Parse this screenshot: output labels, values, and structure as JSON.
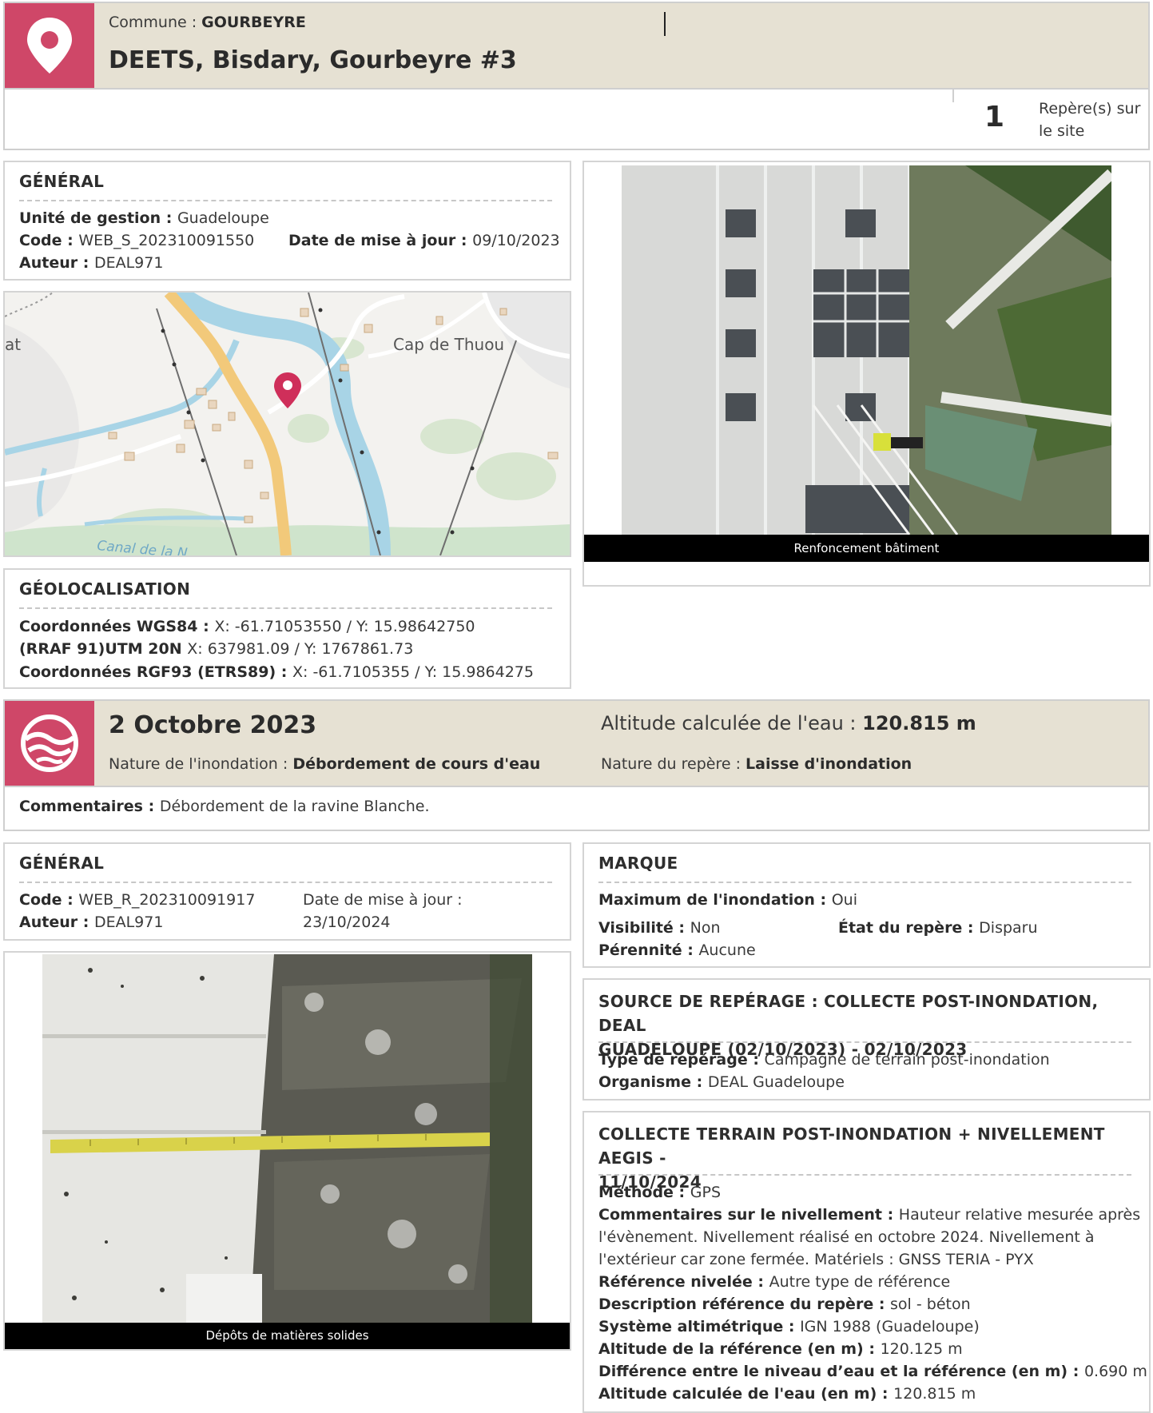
{
  "site_header": {
    "commune_label": "Commune : ",
    "commune_value": "GOURBEYRE",
    "site_title": "DEETS, Bisdary, Gourbeyre #3",
    "marker_count": "1",
    "marker_count_label_line1": "Repère(s) sur",
    "marker_count_label_line2": "le site",
    "accent_color": "#cf4768"
  },
  "site_general": {
    "title": "GÉNÉRAL",
    "unite_label": "Unité de gestion : ",
    "unite_value": "Guadeloupe",
    "code_label": "Code : ",
    "code_value": "WEB_S_202310091550",
    "date_label": "Date de mise à jour : ",
    "date_value": "09/10/2023",
    "auteur_label": "Auteur : ",
    "auteur_value": "DEAL971"
  },
  "map": {
    "label_left": "at",
    "label_place": "Cap de Thuou",
    "label_canal": "Canal de la N",
    "pin_icon": "map-pin-icon"
  },
  "site_photo": {
    "caption": "Renfoncement bâtiment"
  },
  "geoloc": {
    "title": "GÉOLOCALISATION",
    "wgs_label": "Coordonnées WGS84 : ",
    "wgs_value": "X: -61.71053550 / Y: 15.98642750",
    "utm_label": "(RRAF 91)UTM 20N ",
    "utm_value": "X: 637981.09 / Y: 1767861.73",
    "rgf_label": "Coordonnées RGF93 (ETRS89) : ",
    "rgf_value": "X: -61.7105355 / Y: 15.9864275"
  },
  "event_header": {
    "date": "2 Octobre 2023",
    "nature_label": "Nature de l'inondation : ",
    "nature_value": "Débordement de cours d'eau",
    "altitude_label": "Altitude calculée de l'eau : ",
    "altitude_value": "120.815 m",
    "repere_label": "Nature du repère : ",
    "repere_value": "Laisse d'inondation",
    "wave_icon": "flood-wave-icon"
  },
  "comments": {
    "label": "Commentaires : ",
    "value": "Débordement de la ravine Blanche."
  },
  "marker_general": {
    "title": "GÉNÉRAL",
    "code_label": "Code : ",
    "code_value": "WEB_R_202310091917",
    "date_label": "Date de mise à jour :",
    "date_value": "23/10/2024",
    "auteur_label": "Auteur : ",
    "auteur_value": "DEAL971"
  },
  "marker_photo": {
    "caption": "Dépôts de matières solides"
  },
  "marque": {
    "title": "MARQUE",
    "max_label": "Maximum de l'inondation : ",
    "max_value": "Oui",
    "visibilite_label": "Visibilité : ",
    "visibilite_value": "Non",
    "etat_label": "État du repère : ",
    "etat_value": "Disparu",
    "perennite_label": "Pérennité : ",
    "perennite_value": "Aucune"
  },
  "source": {
    "title_line1": "SOURCE DE REPÉRAGE : COLLECTE POST-INONDATION, DEAL",
    "title_line2": "GUADELOUPE (02/10/2023) - 02/10/2023",
    "type_label": "Type de repérage : ",
    "type_value": "Campagne de terrain post-inondation",
    "org_label": "Organisme : ",
    "org_value": "DEAL Guadeloupe"
  },
  "nivellement": {
    "title_line1": "COLLECTE TERRAIN POST-INONDATION + NIVELLEMENT AEGIS -",
    "title_line2": "11/10/2024",
    "methode_label": "Méthode : ",
    "methode_value": "GPS",
    "comm_label": "Commentaires sur le nivellement : ",
    "comm_value_line1": "Hauteur relative mesurée après",
    "comm_value_line2": "l'évènement. Nivellement réalisé en octobre 2024. Nivellement à",
    "comm_value_line3": "l'extérieur car zone fermée. Matériels : GNSS TERIA - PYX",
    "ref_label": "Référence nivelée : ",
    "ref_value": "Autre type de référence",
    "desc_label": "Description référence du repère : ",
    "desc_value": "sol - béton",
    "sys_label": "Système altimétrique : ",
    "sys_value": "IGN 1988 (Guadeloupe)",
    "alt_ref_label": "Altitude de la référence (en m) : ",
    "alt_ref_value": "120.125 m",
    "diff_label": "Différence entre le niveau d’eau et la référence (en m) : ",
    "diff_value": "0.690 m",
    "alt_calc_label": "Altitude calculée de l'eau (en m) : ",
    "alt_calc_value": "120.815 m"
  }
}
